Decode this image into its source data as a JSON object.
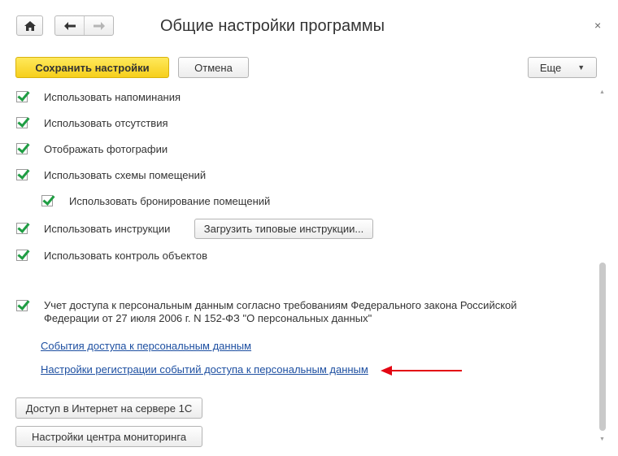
{
  "window": {
    "title": "Общие настройки программы",
    "close_glyph": "×"
  },
  "nav": {
    "home_icon": "home-icon",
    "back_icon": "arrow-left-icon",
    "forward_icon": "arrow-right-icon"
  },
  "toolbar": {
    "save_label": "Сохранить настройки",
    "cancel_label": "Отмена",
    "more_label": "Еще",
    "more_caret": "▼"
  },
  "settings": [
    {
      "label": "Использовать напоминания",
      "checked": true
    },
    {
      "label": "Использовать отсутствия",
      "checked": true
    },
    {
      "label": "Отображать фотографии",
      "checked": true
    },
    {
      "label": "Использовать схемы помещений",
      "checked": true
    },
    {
      "label": "Использовать бронирование помещений",
      "checked": true
    },
    {
      "label": "Использовать инструкции",
      "checked": true
    },
    {
      "label": "Использовать контроль объектов",
      "checked": true
    }
  ],
  "load_instructions_label": "Загрузить типовые инструкции...",
  "personal_data": {
    "label": "Учет доступа к персональным данным согласно требованиям  Федерального закона Российской Федерации от 27 июля 2006 г. N 152-ФЗ \"О персональных данных\"",
    "checked": true,
    "link_events": "События доступа к персональным данным",
    "link_settings": "Настройки регистрации событий доступа к персональным данным"
  },
  "buttons": {
    "internet_access": "Доступ в Интернет на сервере 1С",
    "monitoring_center": "Настройки центра мониторинга"
  },
  "colors": {
    "accent_yellow": "#f6cf1c",
    "checkmark_green": "#1f9d43",
    "link_blue": "#1d4fa1",
    "annotation_red": "#e30613"
  },
  "scrollbar": {
    "up_glyph": "▲",
    "down_glyph": "▼"
  }
}
